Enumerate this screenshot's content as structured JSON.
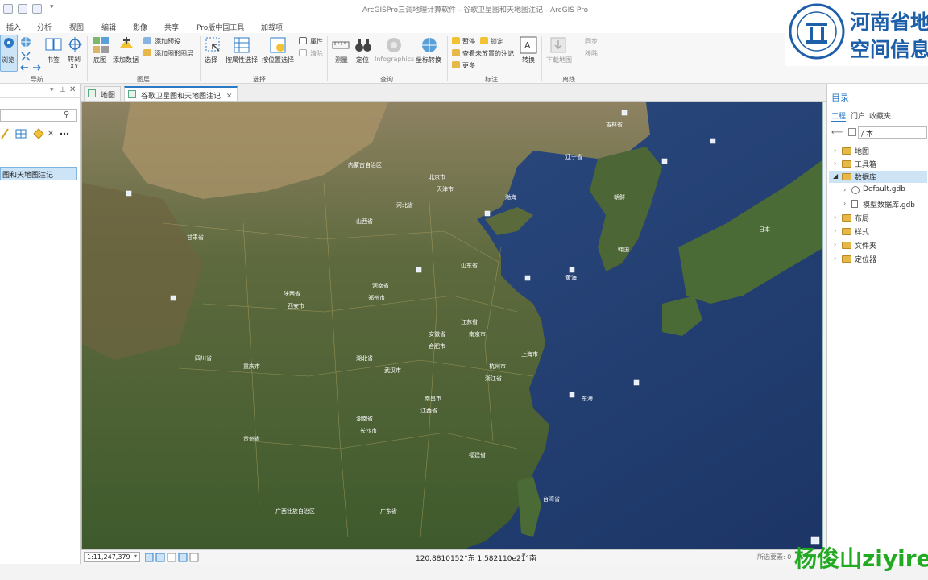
{
  "window": {
    "title": "ArcGISPro三调地理计算软件 - 谷歌卫星图和天地图注记 - ArcGIS Pro"
  },
  "ribbon_tabs": [
    "插入",
    "分析",
    "视图",
    "编辑",
    "影像",
    "共享",
    "Pro版中国工具",
    "加载项"
  ],
  "ribbon": {
    "navigate": {
      "explore": "浏览",
      "locate": "书签",
      "goto": "转到\nXY",
      "group": "导航"
    },
    "layer": {
      "basemap": "底图",
      "add_data": "添加数据",
      "add_preset": "添加预设",
      "add_graphics": "添加图形图层",
      "group": "图层"
    },
    "selection": {
      "select": "选择",
      "by_attr": "按属性选择",
      "by_loc": "按位置选择",
      "attributes": "属性",
      "clear": "清除",
      "group": "选择"
    },
    "inquiry": {
      "measure": "测量",
      "locate": "定位",
      "infographics": "Infographics",
      "coord_convert": "坐标转换",
      "group": "查询"
    },
    "labeling": {
      "pause": "暂停",
      "lock": "锁定",
      "view_unplaced": "查看未放置的注记",
      "more": "更多",
      "convert": "转换",
      "group": "标注"
    },
    "offline": {
      "download": "下载地图",
      "sync": "同步",
      "remove": "移除",
      "group": "离线"
    }
  },
  "logo": {
    "line1": "河南省地",
    "line2": "空间信息"
  },
  "left_panel": {
    "selected_item": "图和天地图注记",
    "search_placeholder": ""
  },
  "view_tabs": [
    {
      "label": "地图",
      "active": false
    },
    {
      "label": "谷歌卫星图和天地图注记",
      "active": true
    }
  ],
  "status": {
    "scale": "1:11,247,379",
    "coordinates": "120.8810152°东 1.582110e21°南",
    "selected_features": "所选要素: 0"
  },
  "catalog": {
    "title": "目录",
    "tabs": [
      "工程",
      "门户",
      "收藏夹"
    ],
    "path": "/ 本",
    "items": [
      {
        "label": "地图",
        "expanded": false
      },
      {
        "label": "工具箱",
        "expanded": false
      },
      {
        "label": "数据库",
        "expanded": true,
        "selected": true
      },
      {
        "label": "Default.gdb",
        "child": true
      },
      {
        "label": "模型数据库.gdb",
        "child": true
      },
      {
        "label": "布局",
        "expanded": false
      },
      {
        "label": "样式",
        "expanded": false
      },
      {
        "label": "文件夹",
        "expanded": false
      },
      {
        "label": "定位器",
        "expanded": false
      }
    ]
  },
  "map_labels": {
    "bohai": "渤海",
    "yellow_sea": "黄海",
    "east_china_sea": "东海",
    "beijing": "北京市",
    "tianjin": "天津市",
    "shandong": "山东省",
    "henan": "河南省",
    "hubei": "湖北省",
    "hunan": "湖南省",
    "jiangxi": "江西省",
    "zhejiang": "浙江省",
    "fujian": "福建省",
    "anhui": "安徽省",
    "jiangsu": "江苏省",
    "shaanxi": "陕西省",
    "shanxi": "山西省",
    "hebei": "河北省",
    "sichuan": "四川省",
    "chongqing": "重庆市",
    "guizhou": "贵州省",
    "gansu": "甘肃省",
    "inner_mongolia": "内蒙古自治区",
    "liaoning": "辽宁省",
    "jilin": "吉林省",
    "korea": "韩国",
    "nk": "朝鲜",
    "japan": "日本",
    "taiwan": "台湾省",
    "shanghai": "上海市",
    "wuhan": "武汉市",
    "changsha": "长沙市",
    "nanchang": "南昌市",
    "hangzhou": "杭州市",
    "xian": "西安市",
    "zhengzhou": "郑州市",
    "hefei": "合肥市",
    "nanjing": "南京市",
    "guangdong": "广东省",
    "guangxi": "广西壮族自治区"
  },
  "watermark": {
    "text": "杨俊山ziyire"
  },
  "colors": {
    "accent": "#2b78c5",
    "selected": "#cde4f7",
    "watermark": "#22aa22"
  }
}
